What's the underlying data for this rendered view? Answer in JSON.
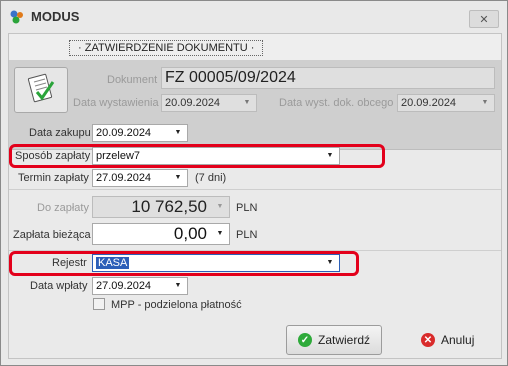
{
  "window": {
    "title": "MODUS",
    "close_glyph": "✕"
  },
  "header": {
    "doc_title": "ZATWIERDZENIE DOKUMENTU"
  },
  "document": {
    "label": "Dokument",
    "value": "FZ 00005/09/2024",
    "issue_date_label": "Data wystawienia",
    "issue_date": "20.09.2024",
    "foreign_date_label": "Data wyst. dok. obcego",
    "foreign_date": "20.09.2024"
  },
  "form": {
    "purchase_date_label": "Data zakupu",
    "purchase_date": "20.09.2024",
    "payment_method_label": "Sposób zapłaty",
    "payment_method": "przelew7",
    "payment_term_label": "Termin zapłaty",
    "payment_term": "27.09.2024",
    "payment_term_days": "(7 dni)",
    "to_pay_label": "Do zapłaty",
    "to_pay": "10 762,50",
    "to_pay_currency": "PLN",
    "current_payment_label": "Zapłata bieżąca",
    "current_payment": "0,00",
    "current_payment_currency": "PLN",
    "register_label": "Rejestr",
    "register": "KASA",
    "payment_date_label": "Data wpłaty",
    "payment_date": "27.09.2024",
    "split_payment_label": "MPP - podzielona płatność",
    "split_payment_checked": false
  },
  "buttons": {
    "confirm": "Zatwierdź",
    "cancel": "Anuluj"
  },
  "colors": {
    "highlight": "#e3001b",
    "selection": "#2c5fb8",
    "confirm_icon": "#2eaa3a",
    "cancel_icon": "#d92b2b"
  },
  "icons": [
    "app-icon",
    "close-icon",
    "document-check-icon",
    "dropdown-arrow-icon",
    "check-circle-icon",
    "cancel-circle-icon"
  ]
}
